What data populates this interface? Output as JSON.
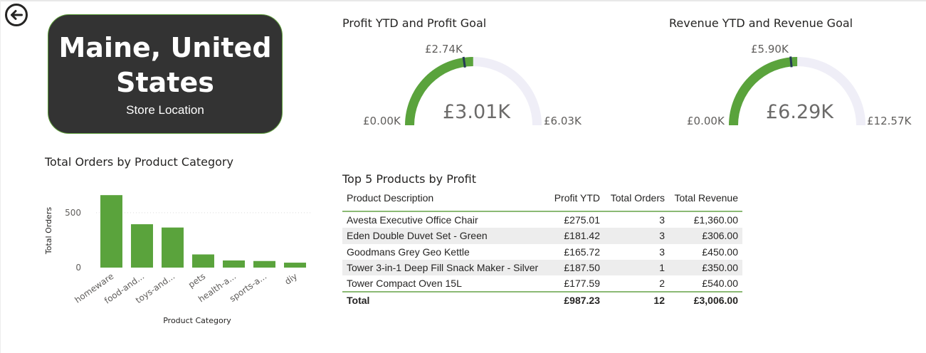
{
  "card": {
    "title_line1": "Maine, United",
    "title_line2": "States",
    "subtitle": "Store Location"
  },
  "profit_gauge": {
    "title": "Profit YTD and Profit Goal",
    "value": 3.01,
    "value_label": "£3.01K",
    "min": 0,
    "min_label": "£0.00K",
    "max": 6.03,
    "max_label": "£6.03K",
    "target": 2.74,
    "target_label": "£2.74K"
  },
  "revenue_gauge": {
    "title": "Revenue YTD and Revenue Goal",
    "value": 6.29,
    "value_label": "£6.29K",
    "min": 0,
    "min_label": "£0.00K",
    "max": 12.57,
    "max_label": "£12.57K",
    "target": 5.9,
    "target_label": "£5.90K"
  },
  "orders_chart_title": "Total Orders by Product Category",
  "chart_data": {
    "type": "bar",
    "categories": [
      "homeware",
      "food-and...",
      "toys-and...",
      "pets",
      "health-a...",
      "sports-a...",
      "diy"
    ],
    "values": [
      660,
      395,
      365,
      120,
      65,
      60,
      45
    ],
    "xlabel": "Product Category",
    "ylabel": "Total Orders",
    "yticks": [
      "0",
      "500"
    ],
    "ylim": [
      0,
      700
    ],
    "grid": true
  },
  "table": {
    "title": "Top 5 Products by Profit",
    "columns": [
      "Product Description",
      "Profit YTD",
      "Total Orders",
      "Total Revenue"
    ],
    "rows": [
      [
        "Avesta Executive Office Chair",
        "£275.01",
        "3",
        "£1,360.00"
      ],
      [
        "Eden Double Duvet Set - Green",
        "£181.42",
        "3",
        "£306.00"
      ],
      [
        "Goodmans Grey Geo Kettle",
        "£165.72",
        "3",
        "£450.00"
      ],
      [
        "Tower 3-in-1 Deep Fill Snack Maker - Silver",
        "£187.50",
        "1",
        "£350.00"
      ],
      [
        "Tower Compact Oven 15L",
        "£177.59",
        "2",
        "£540.00"
      ]
    ],
    "total": [
      "Total",
      "£987.23",
      "12",
      "£3,006.00"
    ]
  },
  "colors": {
    "bar": "#5aa33c",
    "gauge_fill": "#5aa33c",
    "gauge_track": "#efeef7",
    "target": "#253a55",
    "card_bg": "#333333",
    "card_border": "#5e9e3b"
  }
}
